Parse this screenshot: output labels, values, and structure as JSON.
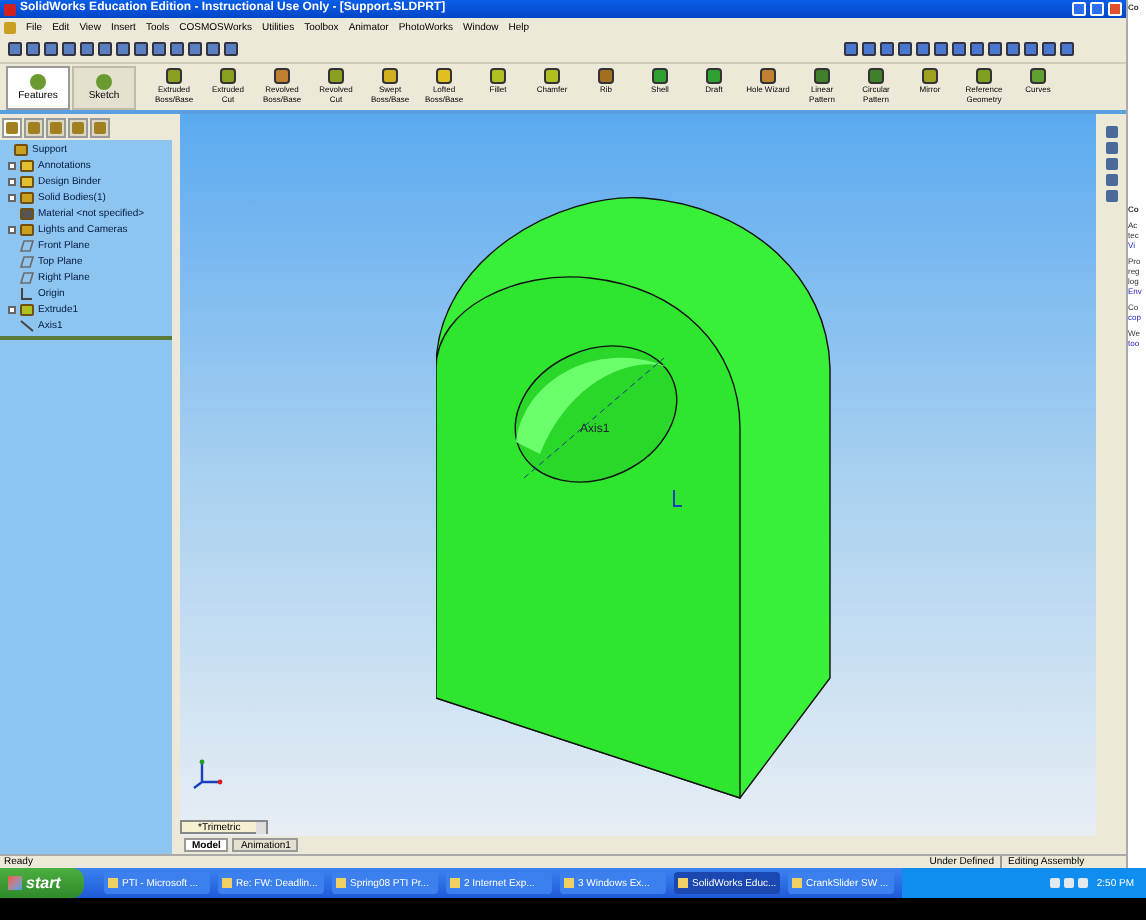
{
  "window": {
    "title": "SolidWorks Education Edition - Instructional Use Only - [Support.SLDPRT]"
  },
  "menu": [
    "File",
    "Edit",
    "View",
    "Insert",
    "Tools",
    "COSMOSWorks",
    "Utilities",
    "Toolbox",
    "Animator",
    "PhotoWorks",
    "Window",
    "Help"
  ],
  "command_manager": {
    "tabs": [
      {
        "label": "Features",
        "selected": true
      },
      {
        "label": "Sketch",
        "selected": false
      }
    ],
    "buttons": [
      {
        "lines": [
          "Extruded",
          "Boss/Base"
        ],
        "color": "#8aa020"
      },
      {
        "lines": [
          "Extruded",
          "Cut"
        ],
        "color": "#8aa020"
      },
      {
        "lines": [
          "Revolved",
          "Boss/Base"
        ],
        "color": "#c08030"
      },
      {
        "lines": [
          "Revolved",
          "Cut"
        ],
        "color": "#8aa020"
      },
      {
        "lines": [
          "Swept",
          "Boss/Base"
        ],
        "color": "#d0b020"
      },
      {
        "lines": [
          "Lofted",
          "Boss/Base"
        ],
        "color": "#e0c020"
      },
      {
        "lines": [
          "Fillet"
        ],
        "color": "#b0c020"
      },
      {
        "lines": [
          "Chamfer"
        ],
        "color": "#b0c020"
      },
      {
        "lines": [
          "Rib"
        ],
        "color": "#a07020"
      },
      {
        "lines": [
          "Shell"
        ],
        "color": "#30a030"
      },
      {
        "lines": [
          "Draft"
        ],
        "color": "#30a030"
      },
      {
        "lines": [
          "Hole Wizard"
        ],
        "color": "#c08030"
      },
      {
        "lines": [
          "Linear",
          "Pattern"
        ],
        "color": "#40802a"
      },
      {
        "lines": [
          "Circular",
          "Pattern"
        ],
        "color": "#40802a"
      },
      {
        "lines": [
          "Mirror"
        ],
        "color": "#a0a020"
      },
      {
        "lines": [
          "Reference",
          "Geometry"
        ],
        "color": "#80a020"
      },
      {
        "lines": [
          "Curves"
        ],
        "color": "#60a030"
      }
    ]
  },
  "feature_tree": {
    "items": [
      {
        "label": "Support",
        "kind": "part",
        "expander": false,
        "children": [
          {
            "label": "Annotations",
            "kind": "annotations",
            "expander": true
          },
          {
            "label": "Design Binder",
            "kind": "binder",
            "expander": true
          },
          {
            "label": "Solid Bodies(1)",
            "kind": "bodies",
            "expander": true
          },
          {
            "label": "Material <not specified>",
            "kind": "material",
            "expander": false
          },
          {
            "label": "Lights and Cameras",
            "kind": "lights",
            "expander": true
          },
          {
            "label": "Front Plane",
            "kind": "plane",
            "expander": false
          },
          {
            "label": "Top Plane",
            "kind": "plane",
            "expander": false
          },
          {
            "label": "Right Plane",
            "kind": "plane",
            "expander": false
          },
          {
            "label": "Origin",
            "kind": "origin",
            "expander": false
          },
          {
            "label": "Extrude1",
            "kind": "feature",
            "expander": true
          },
          {
            "label": "Axis1",
            "kind": "axis",
            "expander": false
          }
        ]
      }
    ]
  },
  "viewport": {
    "axis_label": "Axis1",
    "view_orientation": "*Trimetric",
    "tabs": [
      {
        "label": "Model",
        "selected": true
      },
      {
        "label": "Animation1",
        "selected": false
      }
    ]
  },
  "status_bar": {
    "message": "Ready",
    "sketch_state": "Under Defined",
    "mode": "Editing Assembly"
  },
  "side_window": {
    "texts": [
      {
        "text": "Co",
        "kind": "heading"
      },
      {
        "text": "Co",
        "kind": "heading"
      },
      {
        "text": "Ac",
        "kind": "text"
      },
      {
        "text": "tec",
        "kind": "text"
      },
      {
        "text": "Vi",
        "kind": "link"
      },
      {
        "text": "Pro",
        "kind": "text"
      },
      {
        "text": "reg",
        "kind": "text"
      },
      {
        "text": "log",
        "kind": "text"
      },
      {
        "text": "Env",
        "kind": "link"
      },
      {
        "text": "Co",
        "kind": "text"
      },
      {
        "text": "cop",
        "kind": "link"
      },
      {
        "text": "We",
        "kind": "text"
      },
      {
        "text": "too",
        "kind": "link"
      }
    ]
  },
  "taskbar": {
    "start": "start",
    "items": [
      {
        "label": "PTI - Microsoft ...",
        "selected": false
      },
      {
        "label": "Re: FW: Deadlin...",
        "selected": false
      },
      {
        "label": "Spring08 PTI Pr...",
        "selected": false
      },
      {
        "label": "2 Internet Exp...",
        "selected": false
      },
      {
        "label": "3 Windows Ex...",
        "selected": false
      },
      {
        "label": "SolidWorks Educ...",
        "selected": true
      },
      {
        "label": "CrankSlider SW ...",
        "selected": false
      }
    ],
    "clock": "2:50 PM"
  }
}
